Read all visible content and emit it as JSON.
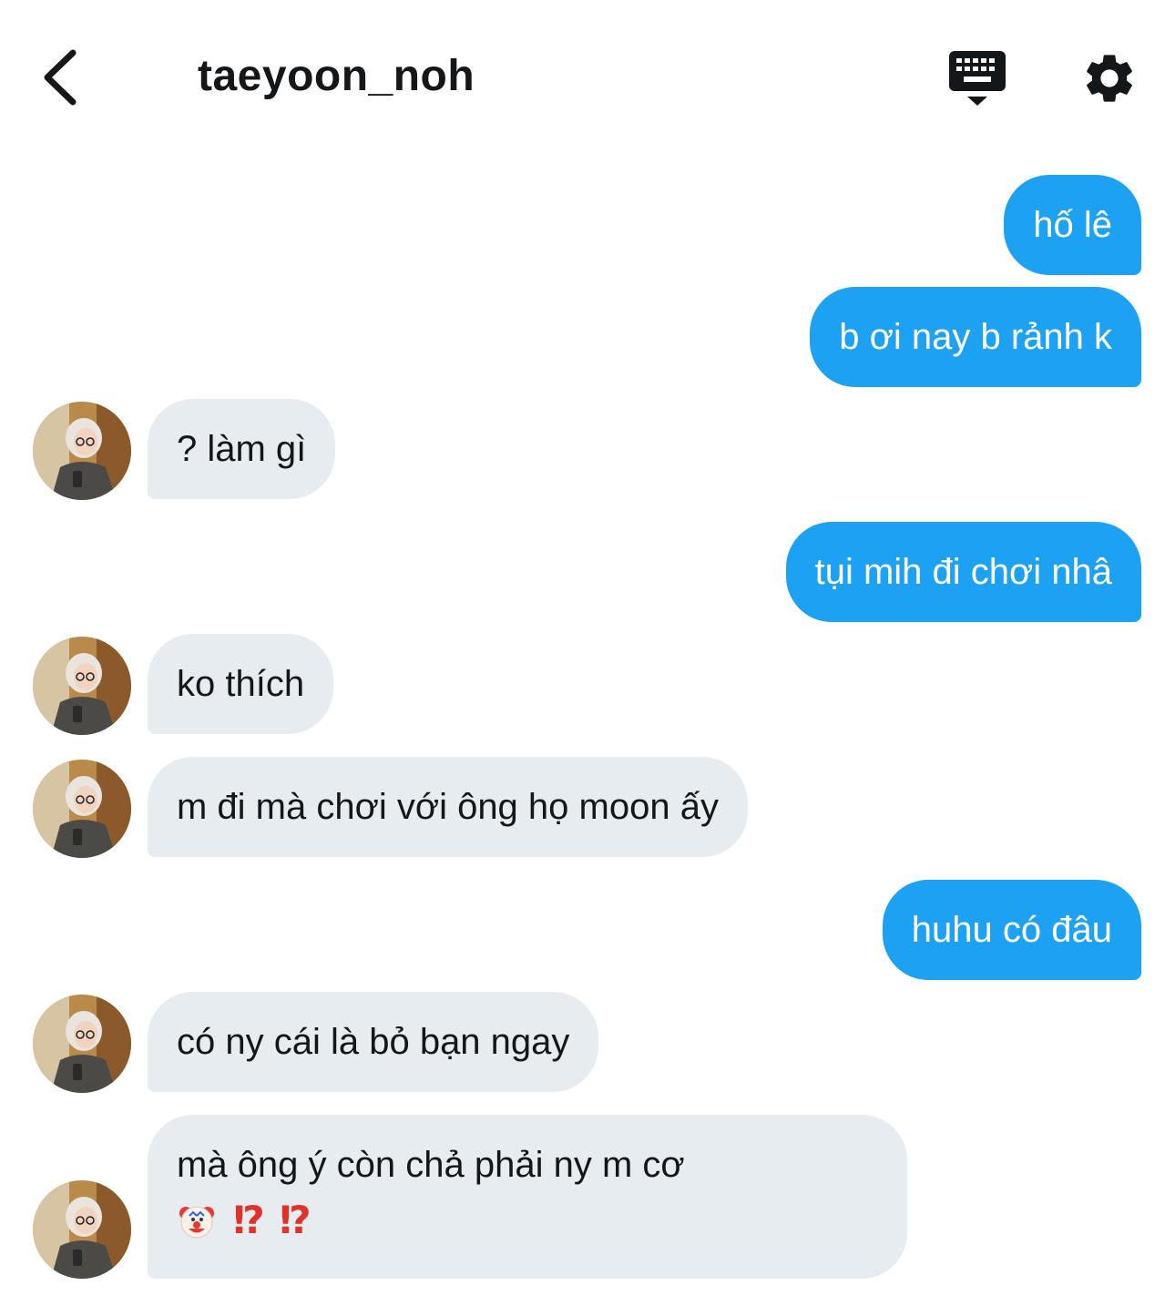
{
  "header": {
    "username": "taeyoon_noh",
    "back_icon": "chevron-left-icon",
    "keyboard_icon": "keyboard-icon",
    "settings_icon": "gear-icon"
  },
  "colors": {
    "outgoing_bubble": "#1da1f2",
    "incoming_bubble": "#e6ecf0",
    "text_primary": "#14171a",
    "emoji_bang": "#e0312b"
  },
  "messages": [
    {
      "direction": "outgoing",
      "text": "hố lê"
    },
    {
      "direction": "outgoing",
      "text": "b ơi nay b rảnh k"
    },
    {
      "direction": "incoming",
      "text": "? làm gì"
    },
    {
      "direction": "outgoing",
      "text": "tụi mih đi chơi nhâ"
    },
    {
      "direction": "incoming",
      "text": "ko thích"
    },
    {
      "direction": "incoming",
      "text": "m đi mà chơi với ông họ moon ấy"
    },
    {
      "direction": "outgoing",
      "text": "huhu có đâu"
    },
    {
      "direction": "incoming",
      "text": "có ny cái là bỏ bạn ngay"
    },
    {
      "direction": "incoming",
      "text": "mà ông ý còn chả phải ny m cơ",
      "emoji_line": [
        "clown-face-emoji",
        "⁉",
        "⁉"
      ]
    }
  ]
}
